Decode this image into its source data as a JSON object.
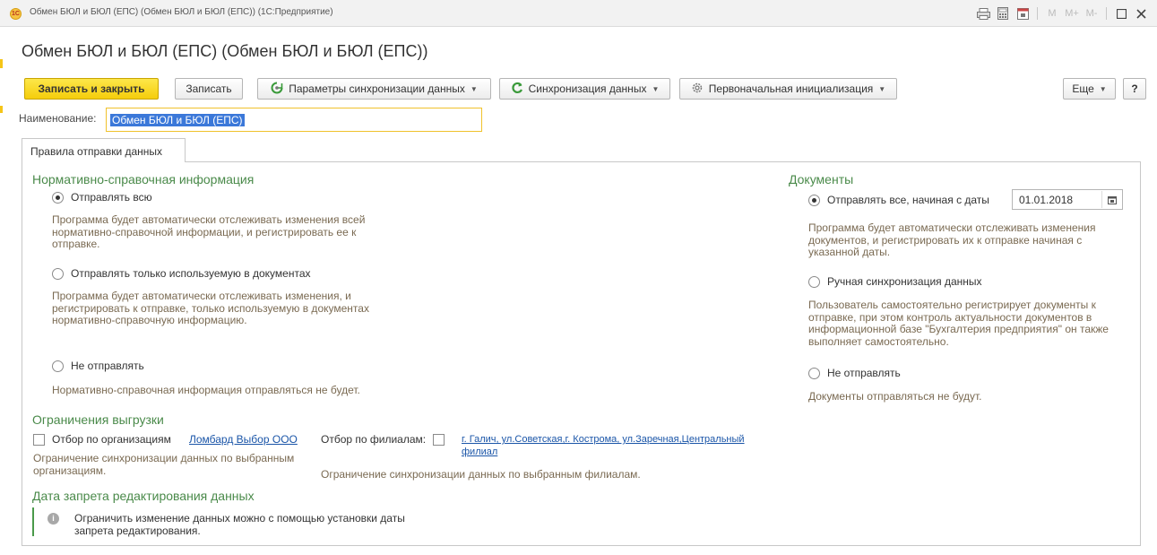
{
  "window": {
    "logo_text": "1С",
    "title": "Обмен БЮЛ и БЮЛ (ЕПС) (Обмен БЮЛ и БЮЛ (ЕПС)) (1С:Предприятие)",
    "m_labels": [
      "M",
      "M+",
      "M-"
    ]
  },
  "form": {
    "title": "Обмен БЮЛ и БЮЛ (ЕПС) (Обмен БЮЛ и БЮЛ (ЕПС))"
  },
  "toolbar": {
    "save_close": "Записать и закрыть",
    "save": "Записать",
    "sync_params": "Параметры синхронизации данных",
    "sync": "Синхронизация данных",
    "initial_init": "Первоначальная инициализация",
    "more": "Еще",
    "help": "?"
  },
  "name": {
    "label": "Наименование:",
    "value": "Обмен БЮЛ и БЮЛ (ЕПС)"
  },
  "tabs": [
    {
      "label": "Правила отправки данных",
      "active": true
    }
  ],
  "nsi": {
    "header": "Нормативно-справочная информация",
    "options": [
      {
        "label": "Отправлять всю",
        "selected": true,
        "desc": [
          "Программа будет автоматически отслеживать изменения всей",
          "нормативно-справочной информации, и регистрировать ее к",
          "отправке."
        ]
      },
      {
        "label": "Отправлять только используемую в документах",
        "selected": false,
        "desc": [
          "Программа будет автоматически отслеживать изменения, и",
          "регистрировать к отправке, только используемую в документах",
          "нормативно-справочную информацию."
        ]
      },
      {
        "label": "Не отправлять",
        "selected": false,
        "desc": [
          "Нормативно-справочная информация отправляться не будет."
        ]
      }
    ]
  },
  "documents": {
    "header": "Документы",
    "date_value": "01.01.2018",
    "options": [
      {
        "label": "Отправлять все, начиная с даты",
        "selected": true,
        "desc": [
          "Программа будет автоматически отслеживать изменения",
          "документов, и регистрировать их к отправке начиная с",
          "указанной даты."
        ]
      },
      {
        "label": "Ручная синхронизация данных",
        "selected": false,
        "desc": [
          "Пользователь самостоятельно регистрирует документы к",
          "отправке, при этом контроль актуальности документов в",
          "информационной базе \"Бухгалтерия предприятия\" он также",
          "выполняет самостоятельно."
        ]
      },
      {
        "label": "Не отправлять",
        "selected": false,
        "desc": [
          "Документы отправляться не будут."
        ]
      }
    ]
  },
  "restrictions": {
    "header": "Ограничения выгрузки",
    "by_org": {
      "label": "Отбор по организациям",
      "checked": false,
      "link": "Ломбард Выбор ООО",
      "desc": [
        "Ограничение синхронизации данных по выбранным",
        "организациям."
      ]
    },
    "by_branch": {
      "label": "Отбор по филиалам:",
      "checked": false,
      "link": [
        "г. Галич, ул.Советская,г. Кострома, ул.Заречная,Центральный",
        "филиал"
      ],
      "desc": "Ограничение синхронизации данных по выбранным филиалам."
    }
  },
  "edit_ban": {
    "header": "Дата запрета редактирования данных",
    "info": [
      "Ограничить изменение данных можно с помощью установки даты",
      "запрета редактирования."
    ]
  },
  "colors": {
    "primary_button": "#f5cd0b",
    "section_header": "#4a8a4a",
    "link": "#1a55a8",
    "description": "#7a6a52"
  }
}
